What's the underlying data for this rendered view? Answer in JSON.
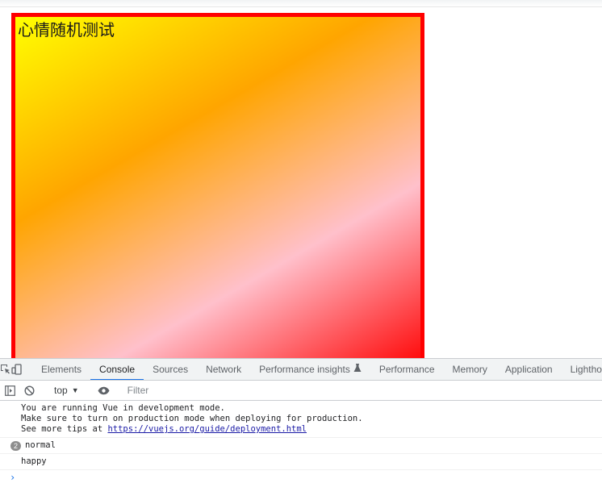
{
  "page": {
    "mood_label": "心情随机测试",
    "colors": {
      "border": "#ff0000",
      "gradient_stops": [
        "#ffff00",
        "#ffa500",
        "#ffc0cb",
        "#ff0000"
      ]
    }
  },
  "devtools": {
    "icons": {
      "inspect": "inspect-element-icon",
      "device": "device-toolbar-icon"
    },
    "tabs": [
      {
        "label": "Elements",
        "active": false
      },
      {
        "label": "Console",
        "active": true
      },
      {
        "label": "Sources",
        "active": false
      },
      {
        "label": "Network",
        "active": false
      },
      {
        "label": "Performance insights",
        "active": false
      },
      {
        "label": "Performance",
        "active": false
      },
      {
        "label": "Memory",
        "active": false
      },
      {
        "label": "Application",
        "active": false
      },
      {
        "label": "Lighthouse",
        "active": false
      }
    ],
    "toolbar": {
      "context": "top",
      "filter_placeholder": "Filter"
    },
    "console": {
      "vue_lines": [
        "You are running Vue in development mode.",
        "Make sure to turn on production mode when deploying for production.",
        "See more tips at "
      ],
      "vue_link": "https://vuejs.org/guide/deployment.html",
      "messages": [
        {
          "count": "2",
          "text": "normal"
        },
        {
          "count": "",
          "text": "happy"
        }
      ],
      "prompt": "›"
    }
  }
}
